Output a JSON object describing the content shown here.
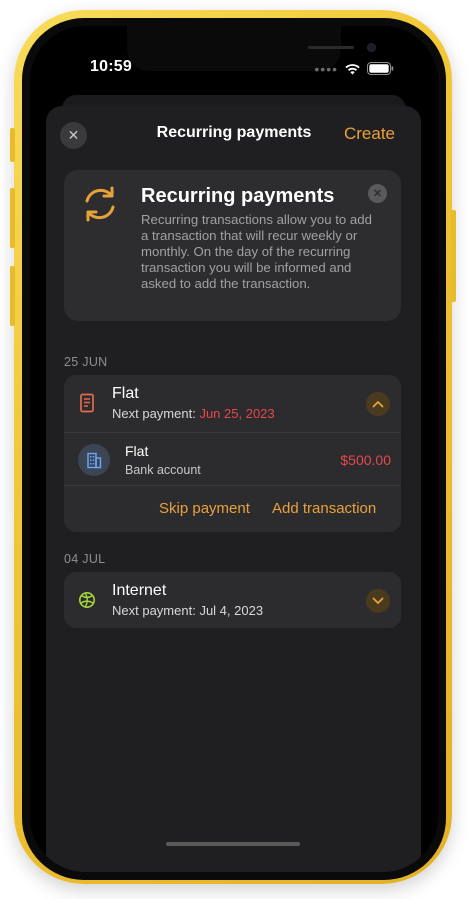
{
  "status_bar": {
    "time": "10:59"
  },
  "header": {
    "title": "Recurring payments",
    "create_label": "Create"
  },
  "info_card": {
    "icon": "recurring-arrows-icon",
    "title": "Recurring payments",
    "text": "Recurring transactions allow you to add a transaction that will recur weekly or monthly. On the day of the recurring transaction you will be informed and asked to add the transaction."
  },
  "sections": [
    {
      "label": "25 JUN",
      "item": {
        "title": "Flat",
        "next_label": "Next payment:",
        "next_date": "Jun 25, 2023",
        "icon": "receipt-icon",
        "expanded": true,
        "transaction": {
          "title": "Flat",
          "account": "Bank account",
          "amount": "$500.00",
          "icon": "building-icon"
        },
        "actions": {
          "skip": "Skip payment",
          "add": "Add transaction"
        }
      }
    },
    {
      "label": "04 JUL",
      "item": {
        "title": "Internet",
        "next_label": "Next payment:",
        "next_date": "Jul 4, 2023",
        "icon": "globe-icon",
        "expanded": false
      }
    }
  ],
  "colors": {
    "accent": "#e8a23a",
    "danger": "#e5484d",
    "internet_icon": "#a7d43a",
    "background": "#1f1f21"
  }
}
